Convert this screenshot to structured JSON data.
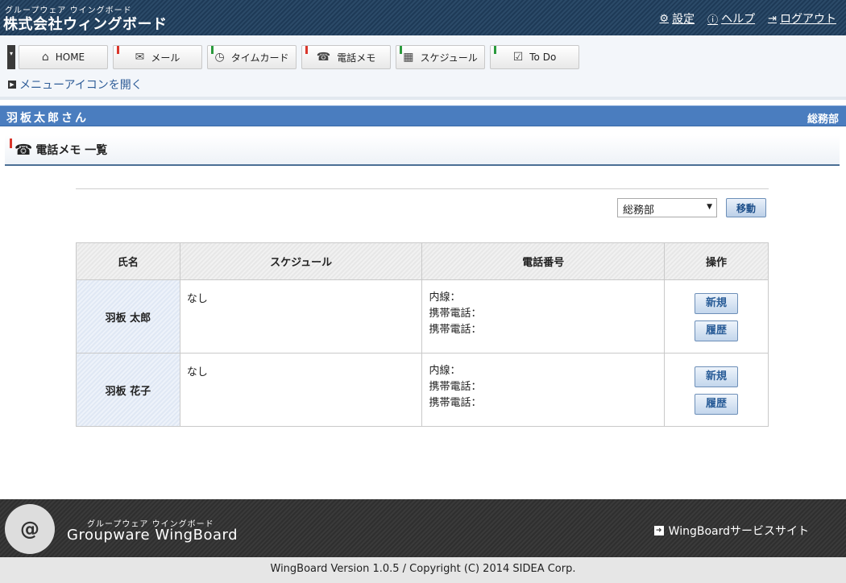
{
  "header": {
    "subtitle": "グループウェア ウイングボード",
    "company": "株式会社ウィングボード",
    "links": [
      {
        "icon": "gear-icon",
        "label": "設定"
      },
      {
        "icon": "help-icon",
        "label": "ヘルプ"
      },
      {
        "icon": "logout-icon",
        "label": "ログアウト"
      }
    ]
  },
  "menu": {
    "tabs": [
      {
        "label": "HOME",
        "icon": "home-icon",
        "mark": "none"
      },
      {
        "label": "メール",
        "icon": "mail-icon",
        "mark": "red"
      },
      {
        "label": "タイムカード",
        "icon": "clock-icon",
        "mark": "green"
      },
      {
        "label": "電話メモ",
        "icon": "phone-memo-icon",
        "mark": "red"
      },
      {
        "label": "スケジュール",
        "icon": "calendar-icon",
        "mark": "green"
      },
      {
        "label": "To Do",
        "icon": "checkbox-icon",
        "mark": "green"
      }
    ],
    "open_label": "メニューアイコンを開く"
  },
  "user": {
    "name": "羽板太郎さん",
    "department": "総務部"
  },
  "page": {
    "title": "電話メモ 一覧"
  },
  "filter": {
    "selected": "総務部",
    "move_label": "移動"
  },
  "table": {
    "headers": [
      "氏名",
      "スケジュール",
      "電話番号",
      "操作"
    ],
    "rows": [
      {
        "name": "羽板 太郎",
        "schedule": "なし",
        "phones": [
          "内線：",
          "携帯電話：",
          "携帯電話："
        ],
        "actions": [
          "新規",
          "履歴"
        ]
      },
      {
        "name": "羽板 花子",
        "schedule": "なし",
        "phones": [
          "内線：",
          "携帯電話：",
          "携帯電話："
        ],
        "actions": [
          "新規",
          "履歴"
        ]
      }
    ]
  },
  "footer": {
    "subtitle": "グループウェア ウイングボード",
    "name": "Groupware WingBoard",
    "service_link": "WingBoardサービスサイト",
    "copyright": "WingBoard Version 1.0.5 / Copyright (C) 2014 SIDEA Corp."
  },
  "colors": {
    "header_bg": "#1e3a57",
    "user_bar": "#4a7dbf",
    "accent_red": "#d9362b",
    "accent_green": "#2a9a3c"
  }
}
